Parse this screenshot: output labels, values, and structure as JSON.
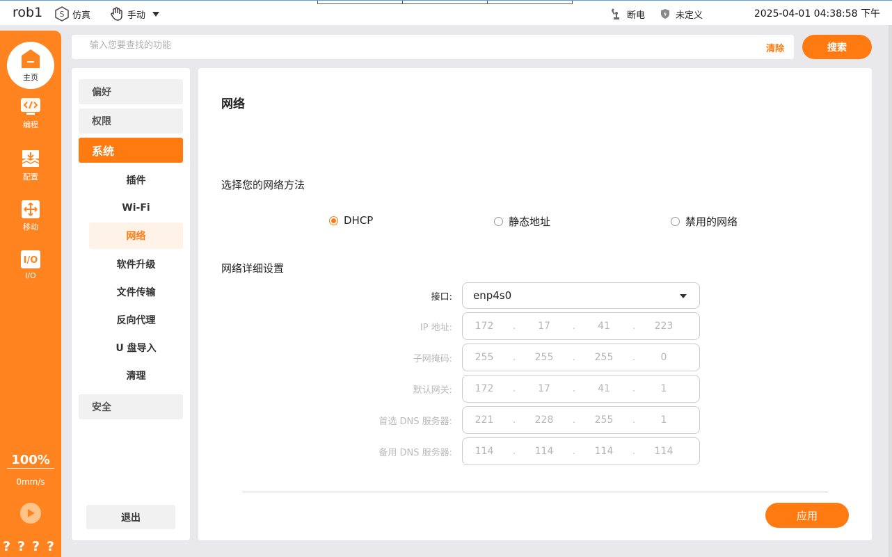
{
  "topbar": {
    "robot_name": "rob1",
    "sim_label": "仿真",
    "manual_label": "手动",
    "power_label": "断电",
    "undefined_label": "未定义",
    "datetime": "2025-04-01 04:38:58 下午"
  },
  "leftnav": {
    "home": "主页",
    "program": "编程",
    "config": "配置",
    "move": "移动",
    "io": "I/O",
    "speed_percent": "100%",
    "speed_value": "0mm/s",
    "question_marks": [
      "?",
      "?",
      "?",
      "?"
    ]
  },
  "search": {
    "placeholder": "输入您要查找的功能",
    "clear_label": "清除",
    "search_label": "搜索"
  },
  "menu": {
    "preferences": "偏好",
    "permissions": "权限",
    "system": "系统",
    "sub": {
      "plugins": "插件",
      "wifi": "Wi-Fi",
      "network": "网络",
      "upgrade": "软件升级",
      "file_transfer": "文件传输",
      "reverse_proxy": "反向代理",
      "usb_import": "U 盘导入",
      "cleanup": "清理"
    },
    "security": "安全",
    "logout": "退出"
  },
  "main": {
    "title": "网络",
    "method_label": "选择您的网络方法",
    "methods": {
      "dhcp": "DHCP",
      "static": "静态地址",
      "disabled": "禁用的网络"
    },
    "selected_method": "DHCP",
    "details_label": "网络详细设置",
    "interface_label": "接口:",
    "interface_value": "enp4s0",
    "fields": {
      "ip": {
        "label": "IP 地址:",
        "octets": [
          "172",
          "17",
          "41",
          "223"
        ]
      },
      "mask": {
        "label": "子网掩码:",
        "octets": [
          "255",
          "255",
          "255",
          "0"
        ]
      },
      "gateway": {
        "label": "默认网关:",
        "octets": [
          "172",
          "17",
          "41",
          "1"
        ]
      },
      "dns1": {
        "label": "首选 DNS 服务器:",
        "octets": [
          "221",
          "228",
          "255",
          "1"
        ]
      },
      "dns2": {
        "label": "备用 DNS 服务器:",
        "octets": [
          "114",
          "114",
          "114",
          "114"
        ]
      }
    },
    "apply_label": "应用"
  },
  "colors": {
    "accent": "#ff7a10",
    "nav_bg": "#ff8420"
  }
}
